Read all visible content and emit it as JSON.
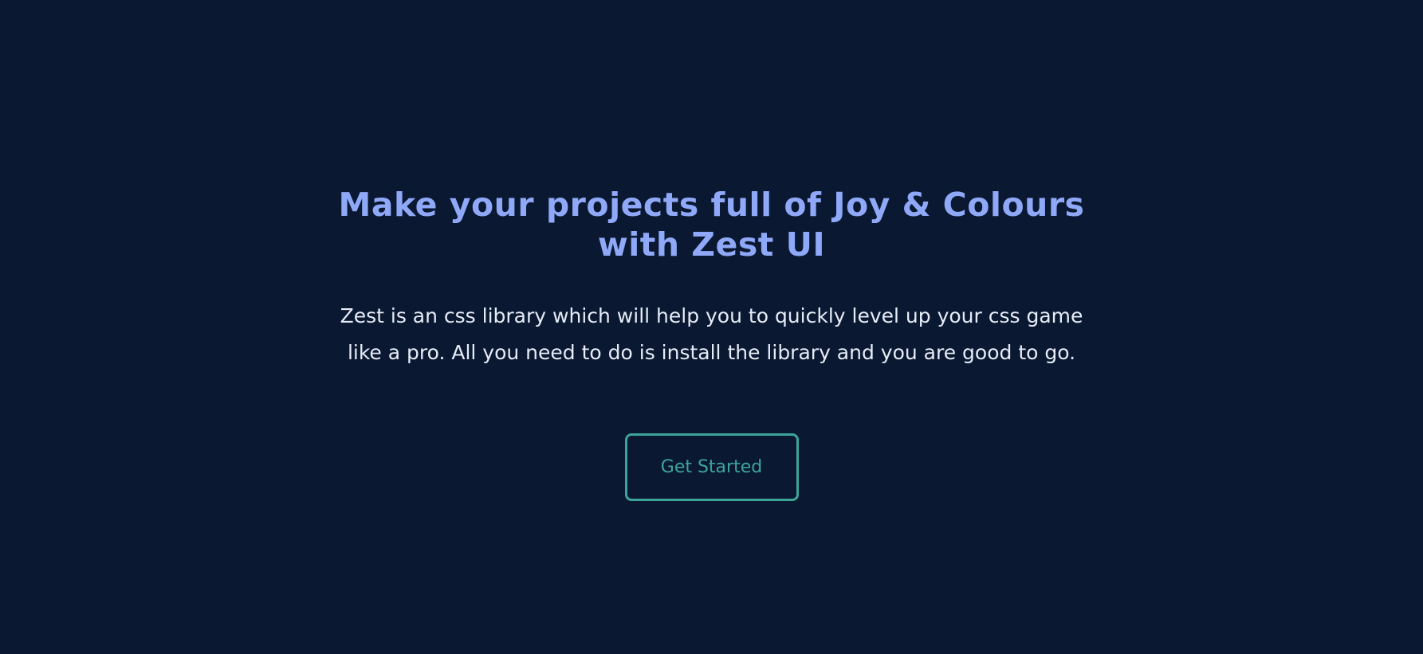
{
  "hero": {
    "title": "Make your projects full of Joy & Colours with Zest UI",
    "description": "Zest is an css library which will help you to quickly level up your css game like a pro. All you need to do is install the library and you are good to go.",
    "cta_label": "Get Started"
  },
  "colors": {
    "background": "#0a1931",
    "title": "#8fa8f8",
    "text": "#e6ecf7",
    "accent": "#3da49a"
  }
}
